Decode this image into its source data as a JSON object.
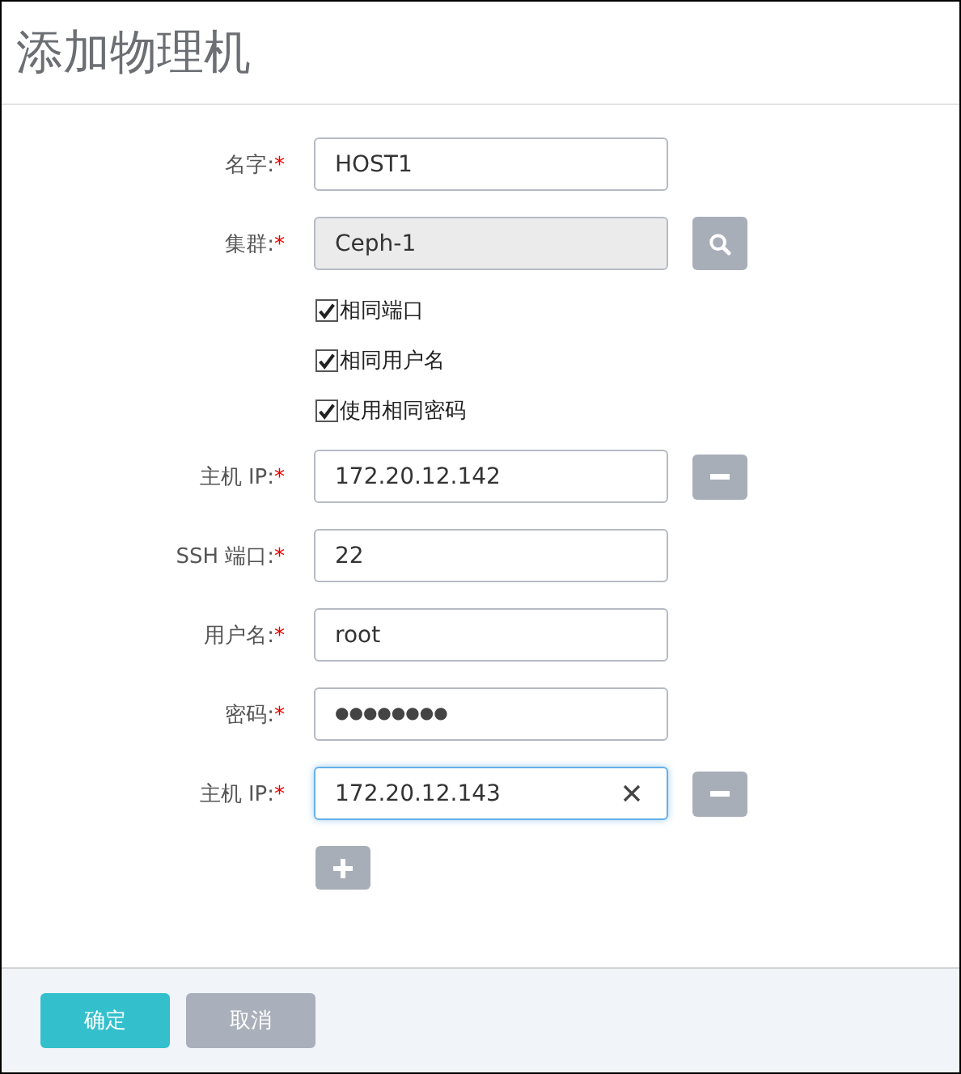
{
  "window": {
    "title": "添加物理机"
  },
  "rows": [
    {
      "kind": "field",
      "label": "名字:",
      "required_mark": "*",
      "value": "HOST1",
      "disabled": false,
      "focused": false
    },
    {
      "kind": "search_field",
      "label": "集群:",
      "required_mark": "*",
      "value": "Ceph-1",
      "disabled": true,
      "focused": false
    },
    {
      "kind": "checkbox",
      "label": "相同端口",
      "checked": true
    },
    {
      "kind": "checkbox",
      "label": "相同用户名",
      "checked": true
    },
    {
      "kind": "checkbox",
      "label": "使用相同密码",
      "checked": true
    },
    {
      "kind": "removable_field",
      "label": "主机 IP:",
      "required_mark": "*",
      "value": "172.20.12.142",
      "disabled": false,
      "focused": false
    },
    {
      "kind": "field",
      "label": "SSH 端口:",
      "required_mark": "*",
      "value": "22",
      "disabled": false,
      "focused": false
    },
    {
      "kind": "field",
      "label": "用户名:",
      "required_mark": "*",
      "value": "root",
      "disabled": false,
      "focused": false
    },
    {
      "kind": "password_field",
      "label": "密码:",
      "required_mark": "*",
      "value": "●●●●●●●●",
      "disabled": false,
      "focused": false
    },
    {
      "kind": "removable_field",
      "label": "主机 IP:",
      "required_mark": "*",
      "value": "172.20.12.143",
      "disabled": false,
      "focused": true,
      "clearable": true
    },
    {
      "kind": "add"
    }
  ],
  "buttons": [
    {
      "label": "确定",
      "kind": "primary"
    },
    {
      "label": "取消",
      "kind": "secondary"
    }
  ]
}
